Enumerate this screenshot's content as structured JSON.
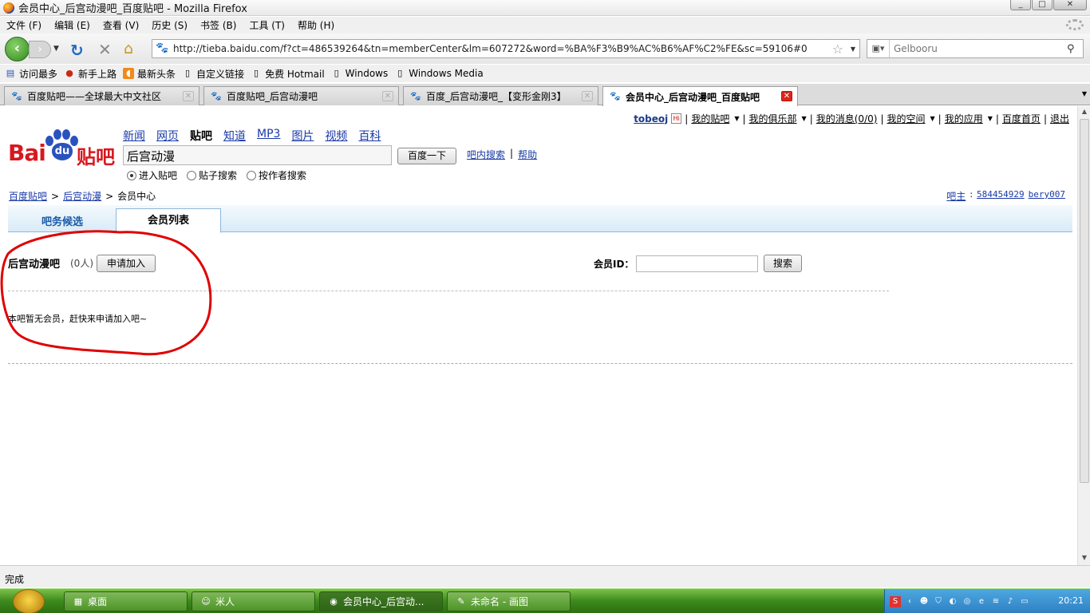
{
  "window": {
    "title": "会员中心_后宫动漫吧_百度贴吧 - Mozilla Firefox"
  },
  "menu": [
    "文件 (F)",
    "编辑 (E)",
    "查看 (V)",
    "历史 (S)",
    "书签 (B)",
    "工具 (T)",
    "帮助 (H)"
  ],
  "nav": {
    "url": "http://tieba.baidu.com/f?ct=486539264&tn=memberCenter&lm=607272&word=%BA%F3%B9%AC%B6%AF%C2%FE&sc=59106#0",
    "search_placeholder": "Gelbooru"
  },
  "bookmarks": [
    "访问最多",
    "新手上路",
    "最新头条",
    "自定义链接",
    "免费 Hotmail",
    "Windows",
    "Windows Media"
  ],
  "tabs": [
    {
      "label": "百度贴吧——全球最大中文社区"
    },
    {
      "label": "百度贴吧_后宫动漫吧"
    },
    {
      "label": "百度_后宫动漫吧_【变形金刚3】"
    },
    {
      "label": "会员中心_后宫动漫吧_百度贴吧"
    }
  ],
  "userbar": {
    "username": "tobeoj",
    "links": [
      "我的贴吧",
      "我的俱乐部",
      "我的消息(0/0)",
      "我的空间",
      "我的应用",
      "百度首页",
      "退出"
    ]
  },
  "logo": {
    "bai": "Bai",
    "du": "du",
    "tieba": "贴吧"
  },
  "channels": [
    "新闻",
    "网页",
    "贴吧",
    "知道",
    "MP3",
    "图片",
    "视频",
    "百科"
  ],
  "search": {
    "query": "后宫动漫",
    "button": "百度一下",
    "inbar_link": "吧内搜索",
    "help_link": "帮助",
    "options": [
      "进入贴吧",
      "贴子搜索",
      "按作者搜索"
    ]
  },
  "breadcrumb": [
    "百度贴吧",
    "后宫动漫",
    "会员中心"
  ],
  "owners": {
    "label": "吧主",
    "names": [
      "584454929",
      "bery007"
    ]
  },
  "pagetabs": [
    "吧务候选",
    "会员列表"
  ],
  "members": {
    "bar_name": "后宫动漫吧",
    "count": "(0人)",
    "join_button": "申请加入",
    "id_label": "会员ID：",
    "search_button": "搜索",
    "empty_message": "本吧暂无会员，赶快来申请加入吧~"
  },
  "status": "完成",
  "taskbar": {
    "items": [
      "桌面",
      "米人",
      "会员中心_后宫动...",
      "未命名 - 画图"
    ],
    "clock": "20:21"
  },
  "colors": {
    "annotation_red": "#e00000",
    "taskbar_green": "#3c8a1c",
    "baidu_red": "#d7181f",
    "baidu_blue": "#2a52be"
  }
}
